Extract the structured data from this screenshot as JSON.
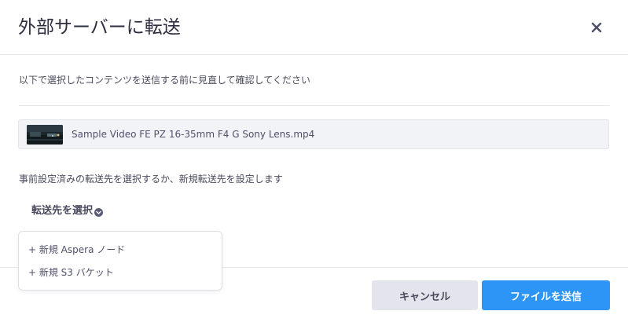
{
  "dialog": {
    "title": "外部サーバーに転送",
    "close_icon": "close-icon"
  },
  "intro_text": "以下で選択したコンテンツを送信する前に見直して確認してください",
  "file": {
    "thumbnail_icon": "video-thumbnail",
    "name": "Sample Video FE PZ 16-35mm F4 G Sony Lens.mp4"
  },
  "destination": {
    "note": "事前設定済みの転送先を選択するか、新規転送先を設定します",
    "select_label": "転送先を選択",
    "select_icon": "chevron-down-icon",
    "menu_items": [
      {
        "label": "+ 新規 Aspera ノード"
      },
      {
        "label": "+ 新規 S3 バケット"
      }
    ]
  },
  "buttons": {
    "cancel_label": "キャンセル",
    "send_label": "ファイルを送信"
  },
  "colors": {
    "primary": "#2d95f5",
    "secondary_button": "#e4e5ec",
    "file_row_bg": "#f2f3f7"
  }
}
